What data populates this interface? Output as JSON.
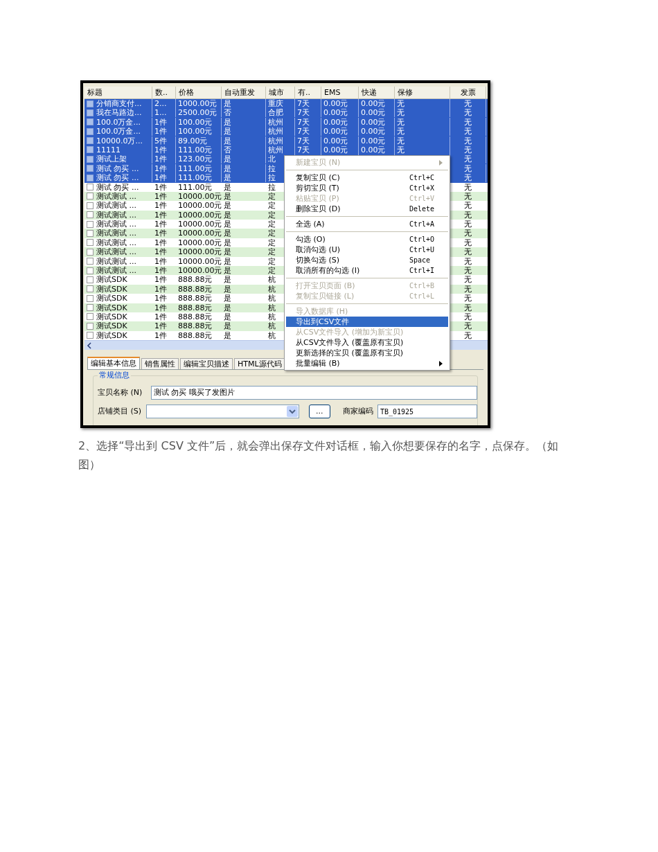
{
  "table": {
    "columns": [
      "标题",
      "数..",
      "价格",
      "自动重发",
      "城市",
      "有..",
      "EMS",
      "快递",
      "保修",
      "发票"
    ],
    "rows": [
      {
        "selected": true,
        "title": "分销商支付...",
        "qty": "2...",
        "price": "1000.00元",
        "auto": "是",
        "city": "重庆",
        "valid": "7天",
        "ems": "0.00元",
        "express": "0.00元",
        "warranty": "无",
        "invoice": "无"
      },
      {
        "selected": true,
        "title": "我在马路边...",
        "qty": "1...",
        "price": "2500.00元",
        "auto": "否",
        "city": "合肥",
        "valid": "7天",
        "ems": "0.00元",
        "express": "0.00元",
        "warranty": "无",
        "invoice": "无"
      },
      {
        "selected": true,
        "title": "100.0万金...",
        "qty": "1件",
        "price": "100.00元",
        "auto": "是",
        "city": "杭州",
        "valid": "7天",
        "ems": "0.00元",
        "express": "0.00元",
        "warranty": "无",
        "invoice": "无"
      },
      {
        "selected": true,
        "title": "100.0万金...",
        "qty": "1件",
        "price": "100.00元",
        "auto": "是",
        "city": "杭州",
        "valid": "7天",
        "ems": "0.00元",
        "express": "0.00元",
        "warranty": "无",
        "invoice": "无"
      },
      {
        "selected": true,
        "title": "10000.0万...",
        "qty": "5件",
        "price": "89.00元",
        "auto": "是",
        "city": "杭州",
        "valid": "7天",
        "ems": "0.00元",
        "express": "0.00元",
        "warranty": "无",
        "invoice": "无"
      },
      {
        "selected": true,
        "title": "11111",
        "qty": "1件",
        "price": "111.00元",
        "auto": "否",
        "city": "杭州",
        "valid": "7天",
        "ems": "0.00元",
        "express": "0.00元",
        "warranty": "无",
        "invoice": "无"
      },
      {
        "selected": true,
        "title": "测试上架",
        "qty": "1件",
        "price": "123.00元",
        "auto": "是",
        "city": "北",
        "invoice": "无"
      },
      {
        "selected": true,
        "title": "测试 勿买 ...",
        "qty": "1件",
        "price": "111.00元",
        "auto": "是",
        "city": "拉",
        "invoice": "无"
      },
      {
        "selected": true,
        "title": "测试 勿买 ...",
        "qty": "1件",
        "price": "111.00元",
        "auto": "是",
        "city": "拉",
        "invoice": "无"
      },
      {
        "selected": false,
        "title": "测试 勿买 ...",
        "qty": "1件",
        "price": "111.00元",
        "auto": "是",
        "city": "拉",
        "invoice": "无"
      },
      {
        "selected": false,
        "title": "测试测试 ...",
        "qty": "1件",
        "price": "10000.00元",
        "auto": "是",
        "city": "定",
        "invoice": "无"
      },
      {
        "selected": false,
        "title": "测试测试 ...",
        "qty": "1件",
        "price": "10000.00元",
        "auto": "是",
        "city": "定",
        "invoice": "无"
      },
      {
        "selected": false,
        "title": "测试测试 ...",
        "qty": "1件",
        "price": "10000.00元",
        "auto": "是",
        "city": "定",
        "invoice": "无"
      },
      {
        "selected": false,
        "title": "测试测试 ...",
        "qty": "1件",
        "price": "10000.00元",
        "auto": "是",
        "city": "定",
        "invoice": "无"
      },
      {
        "selected": false,
        "title": "测试测试 ...",
        "qty": "1件",
        "price": "10000.00元",
        "auto": "是",
        "city": "定",
        "invoice": "无"
      },
      {
        "selected": false,
        "title": "测试测试 ...",
        "qty": "1件",
        "price": "10000.00元",
        "auto": "是",
        "city": "定",
        "invoice": "无"
      },
      {
        "selected": false,
        "title": "测试测试 ...",
        "qty": "1件",
        "price": "10000.00元",
        "auto": "是",
        "city": "定",
        "invoice": "无"
      },
      {
        "selected": false,
        "title": "测试测试 ...",
        "qty": "1件",
        "price": "10000.00元",
        "auto": "是",
        "city": "定",
        "invoice": "无"
      },
      {
        "selected": false,
        "title": "测试测试 ...",
        "qty": "1件",
        "price": "10000.00元",
        "auto": "是",
        "city": "定",
        "invoice": "无"
      },
      {
        "selected": false,
        "title": "测试SDK",
        "qty": "1件",
        "price": "888.88元",
        "auto": "是",
        "city": "杭",
        "invoice": "无"
      },
      {
        "selected": false,
        "title": "测试SDK",
        "qty": "1件",
        "price": "888.88元",
        "auto": "是",
        "city": "杭",
        "invoice": "无"
      },
      {
        "selected": false,
        "title": "测试SDK",
        "qty": "1件",
        "price": "888.88元",
        "auto": "是",
        "city": "杭",
        "invoice": "无"
      },
      {
        "selected": false,
        "title": "测试SDK",
        "qty": "1件",
        "price": "888.88元",
        "auto": "是",
        "city": "杭",
        "invoice": "无"
      },
      {
        "selected": false,
        "title": "测试SDK",
        "qty": "1件",
        "price": "888.88元",
        "auto": "是",
        "city": "杭",
        "invoice": "无"
      },
      {
        "selected": false,
        "title": "测试SDK",
        "qty": "1件",
        "price": "888.88元",
        "auto": "是",
        "city": "杭",
        "invoice": "无"
      },
      {
        "selected": false,
        "title": "测试SDK",
        "qty": "1件",
        "price": "888.88元",
        "auto": "是",
        "city": "杭",
        "invoice": "无"
      }
    ]
  },
  "tabs": [
    {
      "label": "编辑基本信息",
      "selected": true
    },
    {
      "label": "销售属性",
      "selected": false
    },
    {
      "label": "编辑宝贝描述",
      "selected": false
    },
    {
      "label": "HTML源代码",
      "selected": false
    }
  ],
  "group": {
    "title": "常规信息",
    "name_label": "宝贝名称 (N)",
    "name_value": "测试 勿买 哦买了发图片",
    "category_label": "店铺类目 (S)",
    "browse_button": "...",
    "code_label": "商家编码",
    "code_value": "TB_01925"
  },
  "context_menu": [
    {
      "kind": "item",
      "label": "新建宝贝 (N)",
      "disabled": true,
      "selected": false,
      "submenu": true
    },
    {
      "kind": "separator"
    },
    {
      "kind": "item",
      "label": "复制宝贝 (C)",
      "shortcut": "Ctrl+C",
      "disabled": false,
      "selected": false
    },
    {
      "kind": "item",
      "label": "剪切宝贝 (T)",
      "shortcut": "Ctrl+X",
      "disabled": false,
      "selected": false
    },
    {
      "kind": "item",
      "label": "粘贴宝贝 (P)",
      "shortcut": "Ctrl+V",
      "disabled": true,
      "selected": false
    },
    {
      "kind": "item",
      "label": "删除宝贝 (D)",
      "shortcut": "Delete",
      "disabled": false,
      "selected": false
    },
    {
      "kind": "separator"
    },
    {
      "kind": "item",
      "label": "全选 (A)",
      "shortcut": "Ctrl+A",
      "disabled": false,
      "selected": false
    },
    {
      "kind": "separator"
    },
    {
      "kind": "item",
      "label": "勾选 (O)",
      "shortcut": "Ctrl+O",
      "disabled": false,
      "selected": false
    },
    {
      "kind": "item",
      "label": "取消勾选 (U)",
      "shortcut": "Ctrl+U",
      "disabled": false,
      "selected": false
    },
    {
      "kind": "item",
      "label": "切换勾选 (S)",
      "shortcut": "Space",
      "disabled": false,
      "selected": false
    },
    {
      "kind": "item",
      "label": "取消所有的勾选 (I)",
      "shortcut": "Ctrl+I",
      "disabled": false,
      "selected": false
    },
    {
      "kind": "separator"
    },
    {
      "kind": "item",
      "label": "打开宝贝页面 (B)",
      "shortcut": "Ctrl+B",
      "disabled": true,
      "selected": false
    },
    {
      "kind": "item",
      "label": "复制宝贝链接 (L)",
      "shortcut": "Ctrl+L",
      "disabled": true,
      "selected": false
    },
    {
      "kind": "separator"
    },
    {
      "kind": "item",
      "label": "导入数据库 (H)",
      "disabled": true,
      "selected": false
    },
    {
      "kind": "item",
      "label": "导出到CSV文件",
      "disabled": false,
      "selected": true
    },
    {
      "kind": "item",
      "label": "从CSV文件导入 (增加为新宝贝)",
      "disabled": true,
      "selected": false
    },
    {
      "kind": "item",
      "label": "从CSV文件导入 (覆盖原有宝贝)",
      "disabled": false,
      "selected": false
    },
    {
      "kind": "item",
      "label": "更新选择的宝贝 (覆盖原有宝贝)",
      "disabled": false,
      "selected": false
    },
    {
      "kind": "item",
      "label": "批量编辑 (B)",
      "disabled": false,
      "selected": false,
      "submenu": true
    }
  ],
  "caption": "2、选择“导出到 CSV 文件”后，就会弹出保存文件对话框，输入你想要保存的名字，点保存。（如图）"
}
